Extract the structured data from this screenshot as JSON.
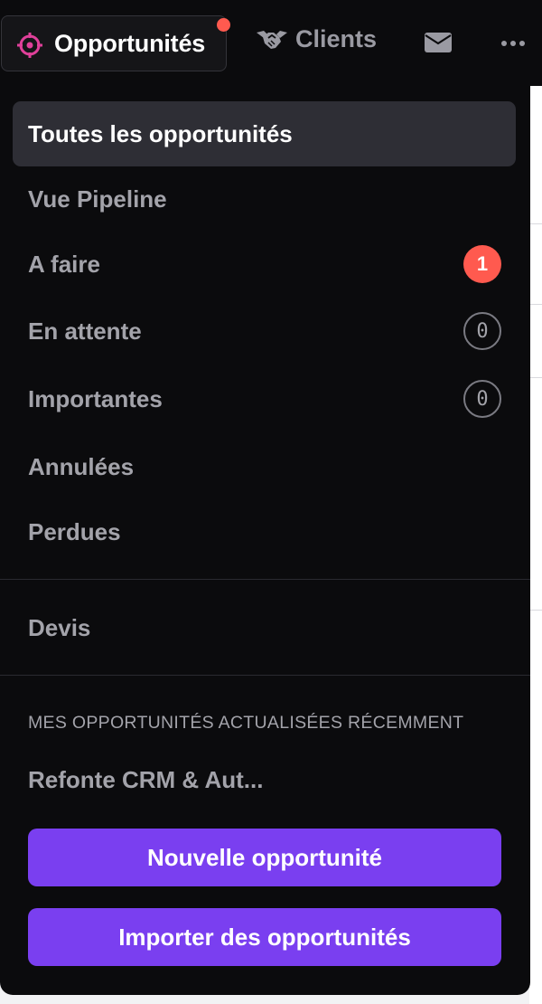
{
  "nav": {
    "active_tab": "Opportunités",
    "clients_tab": "Clients",
    "colors": {
      "accent": "#e0409a",
      "notification": "#ff5a4f"
    }
  },
  "menu": {
    "items": [
      {
        "label": "Toutes les opportunités"
      },
      {
        "label": "Vue Pipeline"
      },
      {
        "label": "A faire",
        "badge": "1"
      },
      {
        "label": "En attente",
        "badge": "0"
      },
      {
        "label": "Importantes",
        "badge": "0"
      },
      {
        "label": "Annulées"
      },
      {
        "label": "Perdues"
      }
    ],
    "devis": "Devis"
  },
  "recent": {
    "title": "MES OPPORTUNITÉS ACTUALISÉES RÉCEMMENT",
    "items": [
      "Refonte CRM & Aut..."
    ]
  },
  "actions": {
    "new_label": "Nouvelle opportunité",
    "import_label": "Importer des opportunités",
    "color": "#7a3ff0"
  }
}
